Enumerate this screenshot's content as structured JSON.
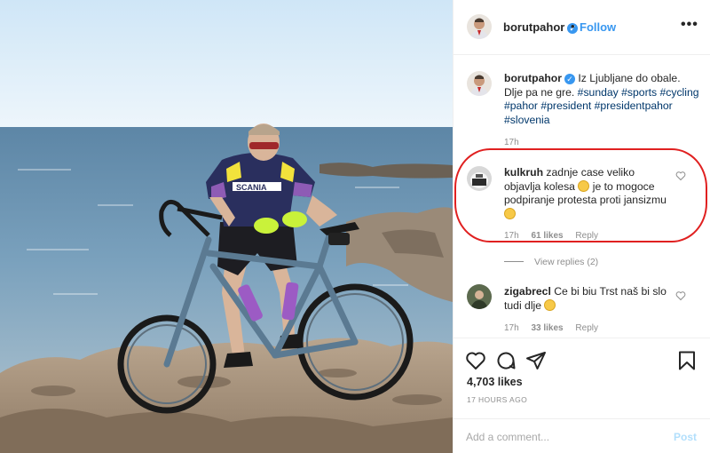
{
  "post": {
    "username": "borutpahor",
    "verified_mark": "✓",
    "dot": "•",
    "follow_label": "Follow",
    "more_label": "•••",
    "photo_subject": "cyclist-on-rocky-shore",
    "jersey_text": "SCANIA"
  },
  "caption": {
    "username": "borutpahor",
    "text": "Iz Ljubljane do obale. Dlje pa ne gre.",
    "hashtags": [
      "#sunday",
      "#sports",
      "#cycling",
      "#pahor",
      "#president",
      "#presidentpahor",
      "#slovenia"
    ],
    "time": "17h"
  },
  "comments": [
    {
      "username": "kulkruh",
      "text_part1": "zadnje case veliko objavlja kolesa",
      "text_part2": "je to mogoce podpiranje protesta proti jansizmu",
      "time": "17h",
      "likes": "61 likes",
      "reply_label": "Reply",
      "view_replies": "View replies (2)",
      "highlighted": true
    },
    {
      "username": "zigabrecl",
      "text": "Ce bi biu Trst naš bi slo tudi dlje",
      "time": "17h",
      "likes": "33 likes",
      "reply_label": "Reply"
    }
  ],
  "actions": {
    "like_icon": "heart-icon",
    "comment_icon": "comment-icon",
    "share_icon": "share-icon",
    "save_icon": "bookmark-icon",
    "likes_count": "4,703 likes",
    "posted": "17 HOURS AGO"
  },
  "add_comment": {
    "placeholder": "Add a comment...",
    "post_label": "Post"
  },
  "colors": {
    "accent": "#3897f0",
    "highlight_ring": "#e02020",
    "muted_text": "#8e8e8e",
    "hashtag": "#00376b"
  }
}
